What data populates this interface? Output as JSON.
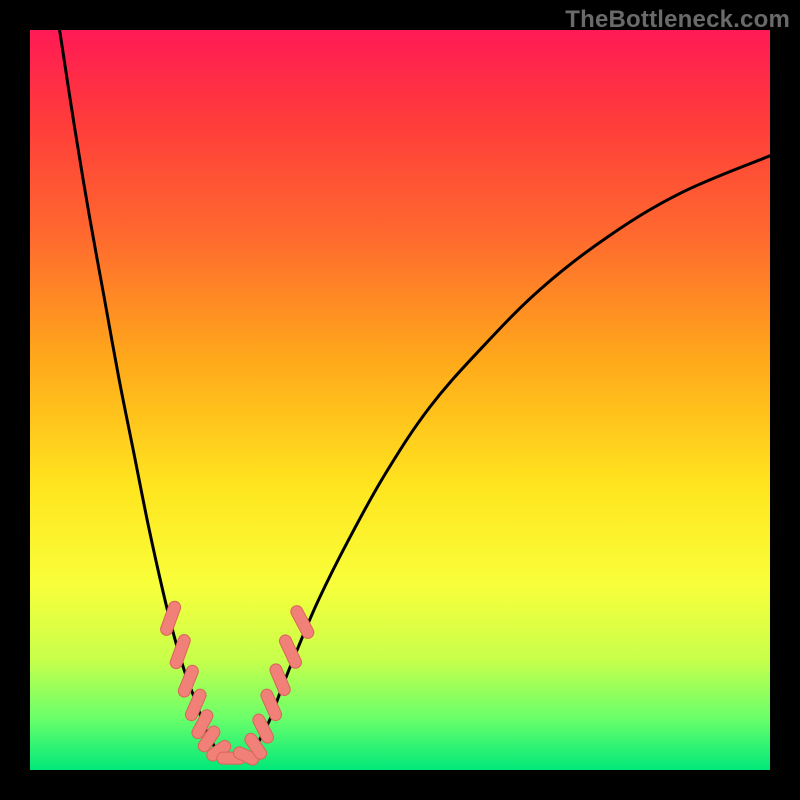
{
  "watermark": "TheBottleneck.com",
  "colors": {
    "background": "#000000",
    "gradient_top": "#ff1a55",
    "gradient_bottom": "#00e87a",
    "curve": "#000000",
    "marker_fill": "#f08078",
    "marker_stroke": "#d8655a"
  },
  "chart_data": {
    "type": "line",
    "title": "",
    "xlabel": "",
    "ylabel": "",
    "xlim": [
      0,
      100
    ],
    "ylim": [
      0,
      100
    ],
    "series": [
      {
        "name": "left_branch",
        "x": [
          4,
          6,
          8,
          10,
          12,
          14,
          16,
          18,
          19.5,
          21,
          22.5,
          23.5,
          24.5,
          25.5
        ],
        "y": [
          100,
          87,
          75,
          64,
          53,
          43,
          33,
          24,
          18,
          13,
          9,
          6,
          4,
          2
        ]
      },
      {
        "name": "right_branch",
        "x": [
          30,
          31,
          32.5,
          34,
          36,
          39,
          43,
          48,
          54,
          61,
          69,
          78,
          88,
          100
        ],
        "y": [
          2,
          4,
          7,
          11,
          16,
          23,
          31,
          40,
          49,
          57,
          65,
          72,
          78,
          83
        ]
      }
    ],
    "floor": {
      "name": "valley_floor",
      "x": [
        25.5,
        27,
        28.5,
        30
      ],
      "y": [
        2,
        1.2,
        1.2,
        2
      ]
    },
    "markers": [
      {
        "x": 19.0,
        "y": 20.5,
        "len": 3.2,
        "angle": -70
      },
      {
        "x": 20.3,
        "y": 16.0,
        "len": 3.2,
        "angle": -70
      },
      {
        "x": 21.4,
        "y": 12.0,
        "len": 3.0,
        "angle": -68
      },
      {
        "x": 22.4,
        "y": 8.8,
        "len": 3.0,
        "angle": -66
      },
      {
        "x": 23.3,
        "y": 6.2,
        "len": 2.8,
        "angle": -62
      },
      {
        "x": 24.2,
        "y": 4.2,
        "len": 2.6,
        "angle": -55
      },
      {
        "x": 25.5,
        "y": 2.6,
        "len": 2.4,
        "angle": -35
      },
      {
        "x": 27.2,
        "y": 1.6,
        "len": 2.6,
        "angle": 0
      },
      {
        "x": 29.2,
        "y": 1.9,
        "len": 2.4,
        "angle": 25
      },
      {
        "x": 30.5,
        "y": 3.2,
        "len": 2.6,
        "angle": 55
      },
      {
        "x": 31.5,
        "y": 5.6,
        "len": 2.8,
        "angle": 63
      },
      {
        "x": 32.6,
        "y": 8.8,
        "len": 3.0,
        "angle": 66
      },
      {
        "x": 33.8,
        "y": 12.2,
        "len": 3.0,
        "angle": 67
      },
      {
        "x": 35.2,
        "y": 16.0,
        "len": 3.2,
        "angle": 65
      },
      {
        "x": 36.8,
        "y": 20.0,
        "len": 3.2,
        "angle": 62
      }
    ]
  }
}
